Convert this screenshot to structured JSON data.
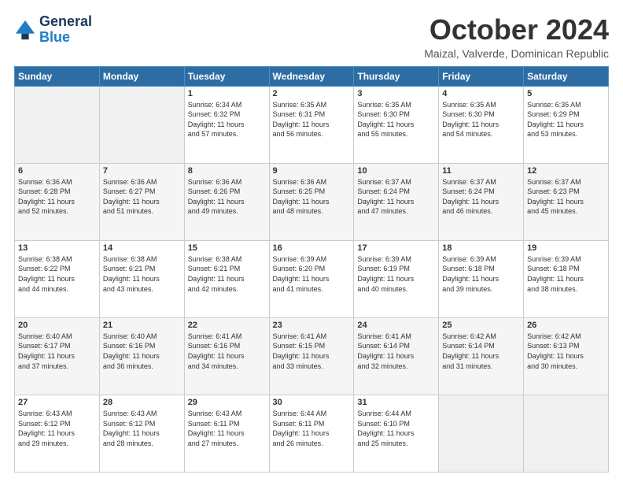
{
  "header": {
    "logo_line1": "General",
    "logo_line2": "Blue",
    "month": "October 2024",
    "location": "Maizal, Valverde, Dominican Republic"
  },
  "days_of_week": [
    "Sunday",
    "Monday",
    "Tuesday",
    "Wednesday",
    "Thursday",
    "Friday",
    "Saturday"
  ],
  "weeks": [
    [
      {
        "day": "",
        "info": ""
      },
      {
        "day": "",
        "info": ""
      },
      {
        "day": "1",
        "info": "Sunrise: 6:34 AM\nSunset: 6:32 PM\nDaylight: 11 hours\nand 57 minutes."
      },
      {
        "day": "2",
        "info": "Sunrise: 6:35 AM\nSunset: 6:31 PM\nDaylight: 11 hours\nand 56 minutes."
      },
      {
        "day": "3",
        "info": "Sunrise: 6:35 AM\nSunset: 6:30 PM\nDaylight: 11 hours\nand 55 minutes."
      },
      {
        "day": "4",
        "info": "Sunrise: 6:35 AM\nSunset: 6:30 PM\nDaylight: 11 hours\nand 54 minutes."
      },
      {
        "day": "5",
        "info": "Sunrise: 6:35 AM\nSunset: 6:29 PM\nDaylight: 11 hours\nand 53 minutes."
      }
    ],
    [
      {
        "day": "6",
        "info": "Sunrise: 6:36 AM\nSunset: 6:28 PM\nDaylight: 11 hours\nand 52 minutes."
      },
      {
        "day": "7",
        "info": "Sunrise: 6:36 AM\nSunset: 6:27 PM\nDaylight: 11 hours\nand 51 minutes."
      },
      {
        "day": "8",
        "info": "Sunrise: 6:36 AM\nSunset: 6:26 PM\nDaylight: 11 hours\nand 49 minutes."
      },
      {
        "day": "9",
        "info": "Sunrise: 6:36 AM\nSunset: 6:25 PM\nDaylight: 11 hours\nand 48 minutes."
      },
      {
        "day": "10",
        "info": "Sunrise: 6:37 AM\nSunset: 6:24 PM\nDaylight: 11 hours\nand 47 minutes."
      },
      {
        "day": "11",
        "info": "Sunrise: 6:37 AM\nSunset: 6:24 PM\nDaylight: 11 hours\nand 46 minutes."
      },
      {
        "day": "12",
        "info": "Sunrise: 6:37 AM\nSunset: 6:23 PM\nDaylight: 11 hours\nand 45 minutes."
      }
    ],
    [
      {
        "day": "13",
        "info": "Sunrise: 6:38 AM\nSunset: 6:22 PM\nDaylight: 11 hours\nand 44 minutes."
      },
      {
        "day": "14",
        "info": "Sunrise: 6:38 AM\nSunset: 6:21 PM\nDaylight: 11 hours\nand 43 minutes."
      },
      {
        "day": "15",
        "info": "Sunrise: 6:38 AM\nSunset: 6:21 PM\nDaylight: 11 hours\nand 42 minutes."
      },
      {
        "day": "16",
        "info": "Sunrise: 6:39 AM\nSunset: 6:20 PM\nDaylight: 11 hours\nand 41 minutes."
      },
      {
        "day": "17",
        "info": "Sunrise: 6:39 AM\nSunset: 6:19 PM\nDaylight: 11 hours\nand 40 minutes."
      },
      {
        "day": "18",
        "info": "Sunrise: 6:39 AM\nSunset: 6:18 PM\nDaylight: 11 hours\nand 39 minutes."
      },
      {
        "day": "19",
        "info": "Sunrise: 6:39 AM\nSunset: 6:18 PM\nDaylight: 11 hours\nand 38 minutes."
      }
    ],
    [
      {
        "day": "20",
        "info": "Sunrise: 6:40 AM\nSunset: 6:17 PM\nDaylight: 11 hours\nand 37 minutes."
      },
      {
        "day": "21",
        "info": "Sunrise: 6:40 AM\nSunset: 6:16 PM\nDaylight: 11 hours\nand 36 minutes."
      },
      {
        "day": "22",
        "info": "Sunrise: 6:41 AM\nSunset: 6:16 PM\nDaylight: 11 hours\nand 34 minutes."
      },
      {
        "day": "23",
        "info": "Sunrise: 6:41 AM\nSunset: 6:15 PM\nDaylight: 11 hours\nand 33 minutes."
      },
      {
        "day": "24",
        "info": "Sunrise: 6:41 AM\nSunset: 6:14 PM\nDaylight: 11 hours\nand 32 minutes."
      },
      {
        "day": "25",
        "info": "Sunrise: 6:42 AM\nSunset: 6:14 PM\nDaylight: 11 hours\nand 31 minutes."
      },
      {
        "day": "26",
        "info": "Sunrise: 6:42 AM\nSunset: 6:13 PM\nDaylight: 11 hours\nand 30 minutes."
      }
    ],
    [
      {
        "day": "27",
        "info": "Sunrise: 6:43 AM\nSunset: 6:12 PM\nDaylight: 11 hours\nand 29 minutes."
      },
      {
        "day": "28",
        "info": "Sunrise: 6:43 AM\nSunset: 6:12 PM\nDaylight: 11 hours\nand 28 minutes."
      },
      {
        "day": "29",
        "info": "Sunrise: 6:43 AM\nSunset: 6:11 PM\nDaylight: 11 hours\nand 27 minutes."
      },
      {
        "day": "30",
        "info": "Sunrise: 6:44 AM\nSunset: 6:11 PM\nDaylight: 11 hours\nand 26 minutes."
      },
      {
        "day": "31",
        "info": "Sunrise: 6:44 AM\nSunset: 6:10 PM\nDaylight: 11 hours\nand 25 minutes."
      },
      {
        "day": "",
        "info": ""
      },
      {
        "day": "",
        "info": ""
      }
    ]
  ]
}
